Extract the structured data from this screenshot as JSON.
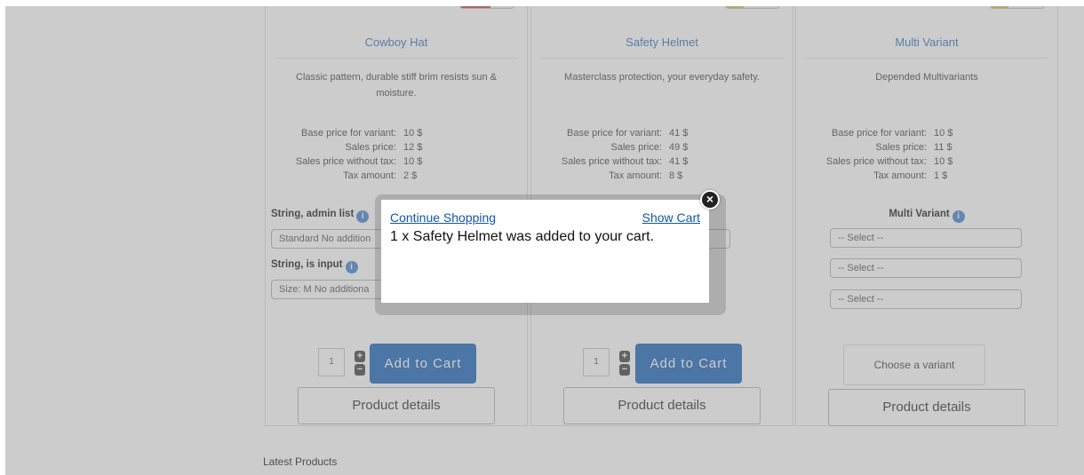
{
  "products": [
    {
      "title": "Cowboy Hat",
      "description": "Classic pattern, durable stiff brim resists sun & moisture.",
      "prices": [
        {
          "label": "Base price for variant:",
          "value": "10 $"
        },
        {
          "label": "Sales price:",
          "value": "12 $"
        },
        {
          "label": "Sales price without tax:",
          "value": "10 $"
        },
        {
          "label": "Tax amount:",
          "value": "2 $"
        }
      ],
      "fields": [
        {
          "label": "String, admin list",
          "select": "Standard No addition"
        },
        {
          "label": "String, is input",
          "select": "Size: M No additiona"
        }
      ],
      "quantity": "1",
      "add_to_cart": "Add to Cart",
      "details": "Product details"
    },
    {
      "title": "Safety Helmet",
      "description": "Masterclass protection, your everyday safety.",
      "prices": [
        {
          "label": "Base price for variant:",
          "value": "41 $"
        },
        {
          "label": "Sales price:",
          "value": "49 $"
        },
        {
          "label": "Sales price without tax:",
          "value": "41 $"
        },
        {
          "label": "Tax amount:",
          "value": "8 $"
        }
      ],
      "quantity": "1",
      "add_to_cart": "Add to Cart",
      "details": "Product details"
    },
    {
      "title": "Multi Variant",
      "description": "Depended Multivariants",
      "prices": [
        {
          "label": "Base price for variant:",
          "value": "10 $"
        },
        {
          "label": "Sales price:",
          "value": "11 $"
        },
        {
          "label": "Sales price without tax:",
          "value": "10 $"
        },
        {
          "label": "Tax amount:",
          "value": "1 $"
        }
      ],
      "variant_label": "Multi Variant",
      "selects": [
        "-- Select --",
        "-- Select --",
        "-- Select --"
      ],
      "choose_variant": "Choose a variant",
      "details": "Product details"
    }
  ],
  "latest_products": "Latest Products",
  "popup": {
    "continue_shopping": "Continue Shopping",
    "show_cart": "Show Cart",
    "message": "1 x Safety Helmet was added to your cart."
  },
  "colors": {
    "accent_blue": "#2f74c0",
    "link_blue": "#1155aa",
    "title_blue": "#4a7fc1",
    "star": "#e7a95a"
  }
}
